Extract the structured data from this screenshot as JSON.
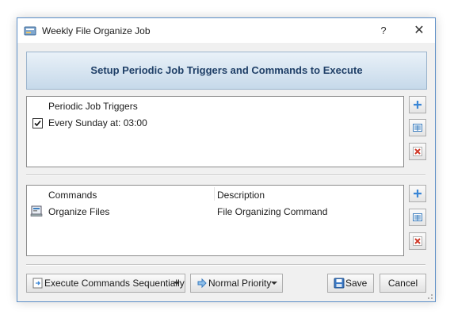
{
  "window": {
    "title": "Weekly File Organize Job",
    "help_label": "?",
    "close_label": "✕"
  },
  "banner": {
    "text": "Setup Periodic Job Triggers and Commands to Execute"
  },
  "triggers": {
    "header": "Periodic Job Triggers",
    "rows": [
      {
        "checked": true,
        "label": "Every Sunday at: 03:00"
      }
    ]
  },
  "commands": {
    "columns": [
      "Commands",
      "Description"
    ],
    "rows": [
      {
        "name": "Organize Files",
        "description": "File Organizing Command"
      }
    ]
  },
  "footer": {
    "execution_mode": "Execute Commands Sequentially",
    "priority": "Normal Priority",
    "save_label": "Save",
    "cancel_label": "Cancel"
  },
  "colors": {
    "window_border": "#5b8ec7",
    "banner_text": "#1f3f67",
    "add_icon": "#3a86d6",
    "remove_icon": "#d03a2a"
  },
  "icons": [
    "app-icon",
    "add-icon",
    "edit-icon",
    "remove-icon",
    "command-icon",
    "sequence-icon",
    "priority-arrow-icon",
    "save-disk-icon"
  ]
}
